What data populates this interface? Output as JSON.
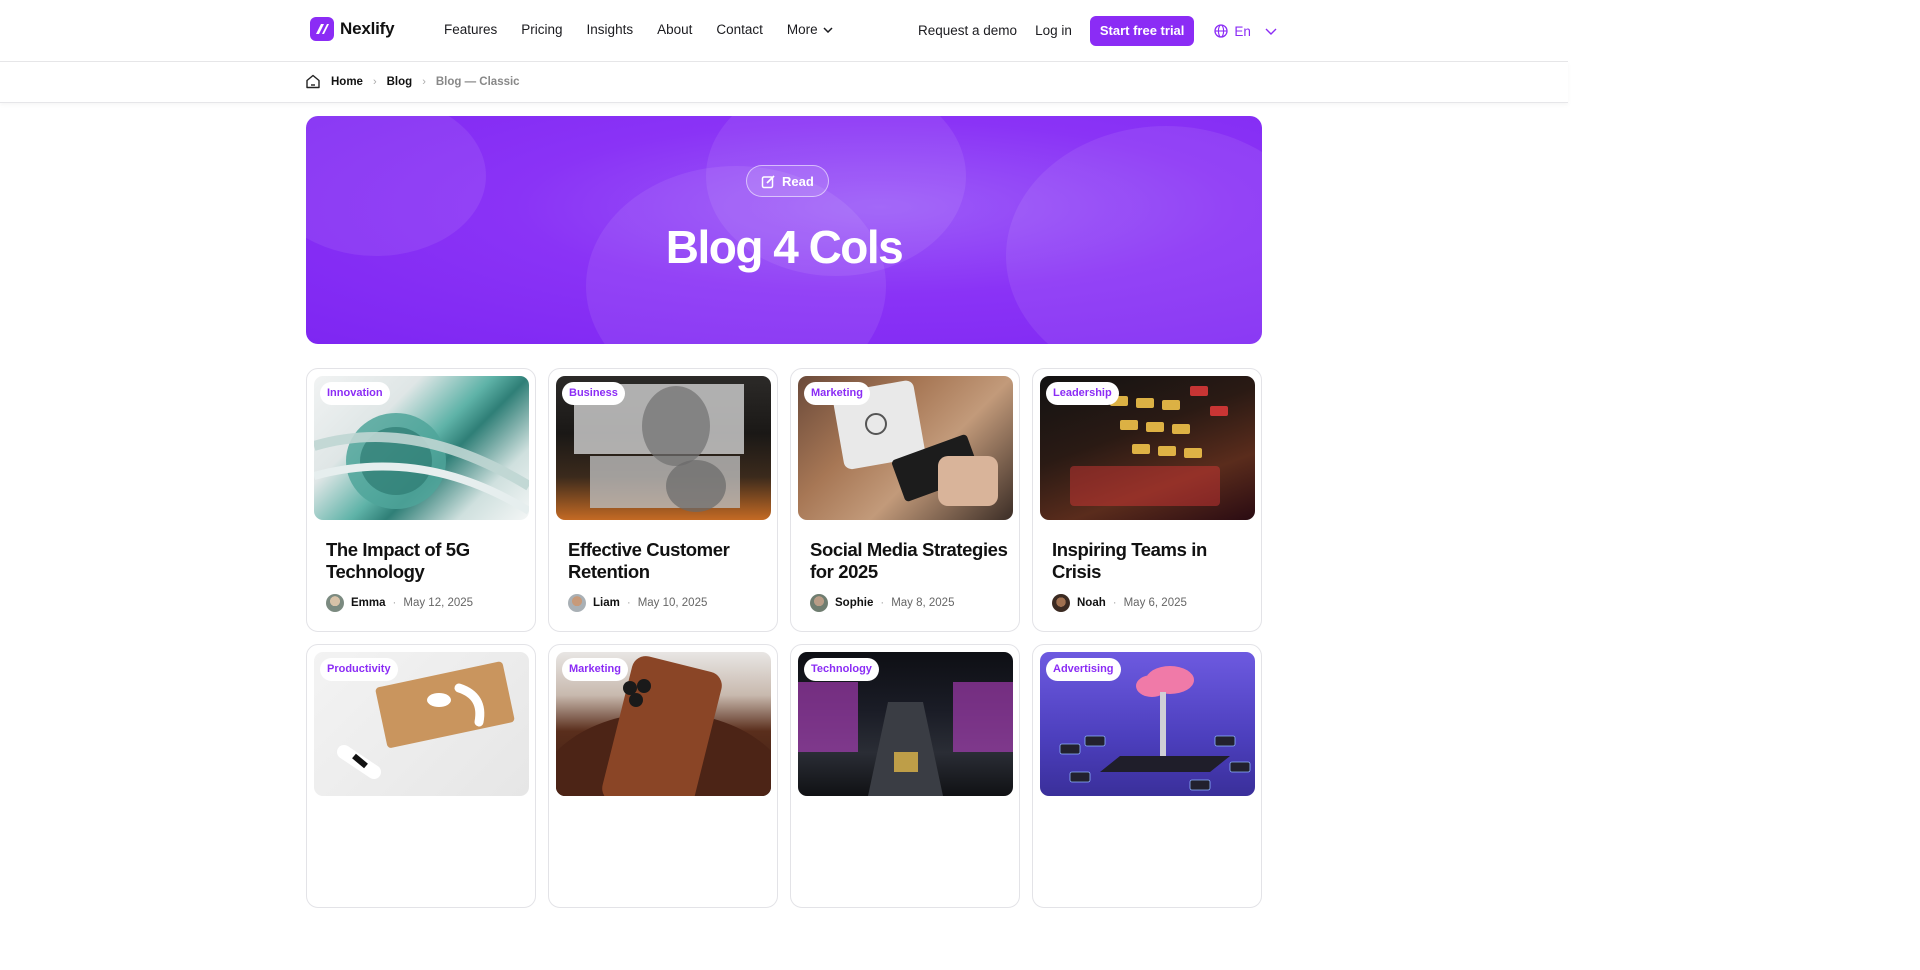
{
  "brand": {
    "name": "Nexlify",
    "accent": "#8b2cf5"
  },
  "nav": {
    "items": [
      "Features",
      "Pricing",
      "Insights",
      "About",
      "Contact"
    ],
    "more_label": "More",
    "request_demo": "Request a demo",
    "login": "Log in",
    "trial": "Start free trial",
    "language": "En"
  },
  "breadcrumb": {
    "home": "Home",
    "blog": "Blog",
    "current": "Blog — Classic"
  },
  "hero": {
    "pill": "Read",
    "title": "Blog 4 Cols"
  },
  "posts": [
    {
      "tag": "Innovation",
      "title": "The Impact of 5G Technology",
      "author": "Emma",
      "date": "May 12, 2025"
    },
    {
      "tag": "Business",
      "title": "Effective Customer Retention",
      "author": "Liam",
      "date": "May 10, 2025"
    },
    {
      "tag": "Marketing",
      "title": "Social Media Strategies for 2025",
      "author": "Sophie",
      "date": "May 8, 2025"
    },
    {
      "tag": "Leadership",
      "title": "Inspiring Teams in Crisis",
      "author": "Noah",
      "date": "May 6, 2025"
    },
    {
      "tag": "Productivity",
      "title": "",
      "author": "",
      "date": ""
    },
    {
      "tag": "Marketing",
      "title": "",
      "author": "",
      "date": ""
    },
    {
      "tag": "Technology",
      "title": "",
      "author": "",
      "date": ""
    },
    {
      "tag": "Advertising",
      "title": "",
      "author": "",
      "date": ""
    }
  ]
}
